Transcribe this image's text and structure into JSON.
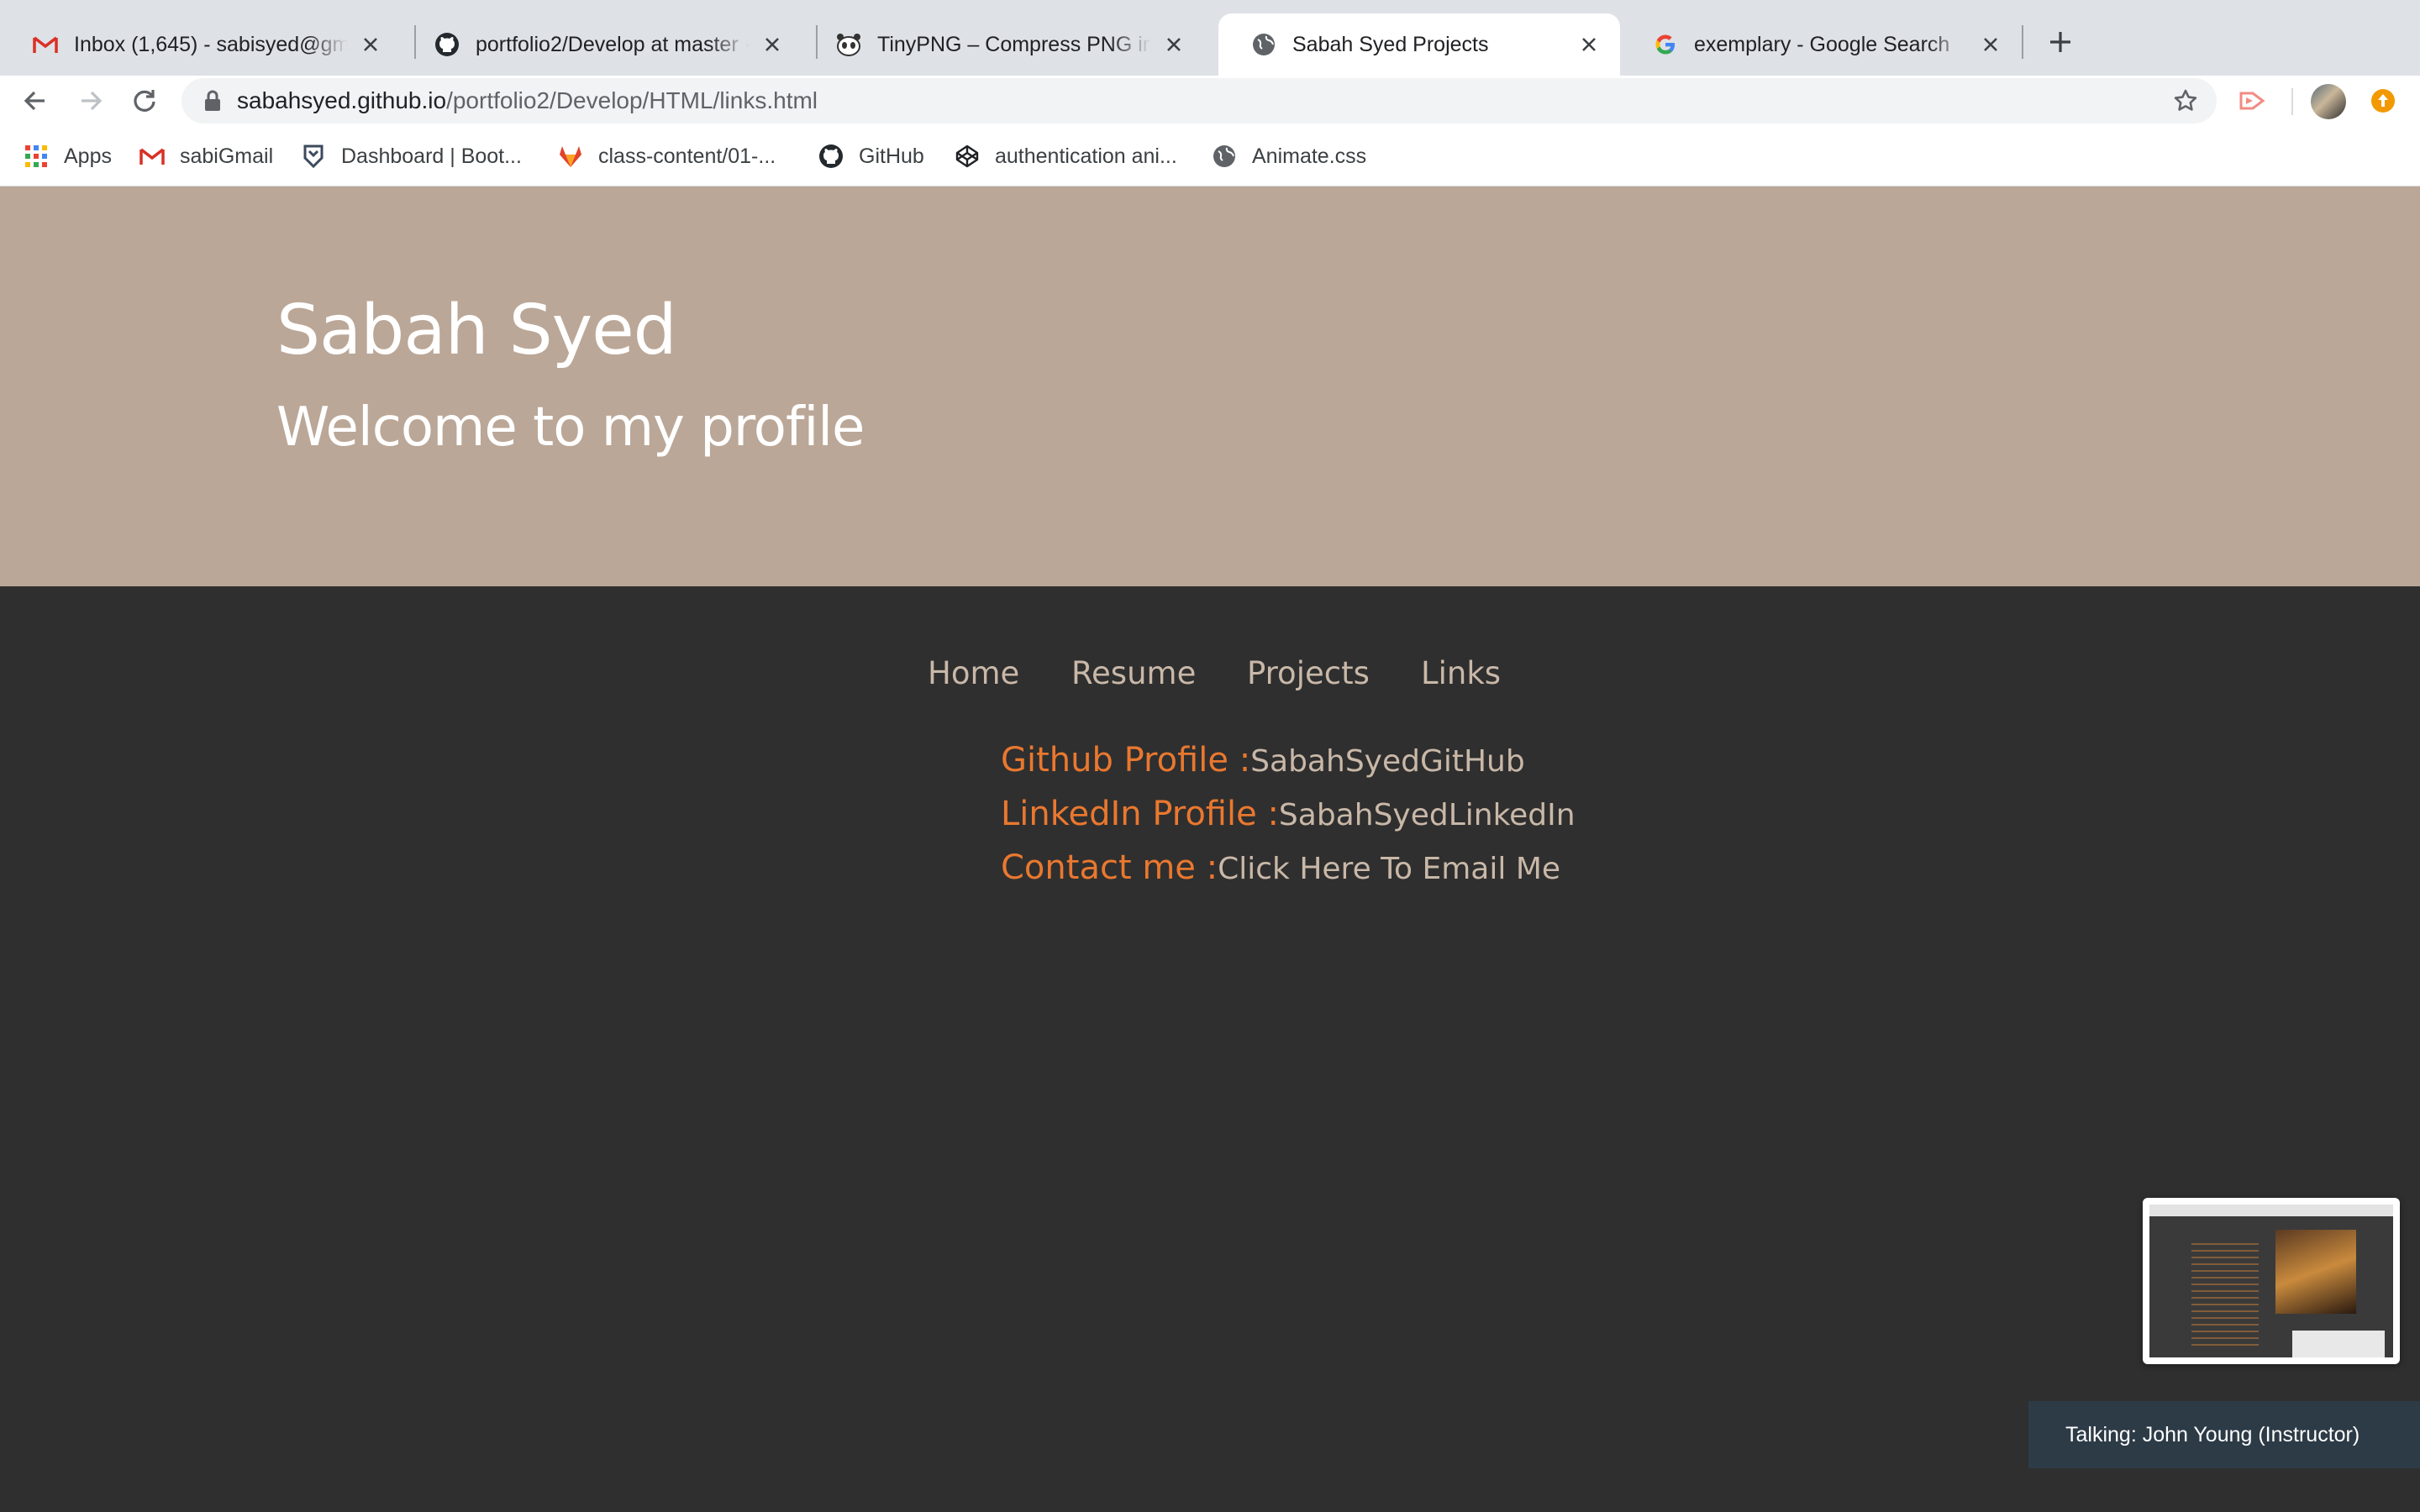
{
  "browser": {
    "tabs": [
      {
        "title": "Inbox (1,645) - sabisyed@gmail.com",
        "icon": "gmail-icon",
        "active": false
      },
      {
        "title": "portfolio2/Develop at master · sabahsyed",
        "icon": "github-icon",
        "active": false
      },
      {
        "title": "TinyPNG – Compress PNG images",
        "icon": "tinypng-panda-icon",
        "active": false
      },
      {
        "title": "Sabah Syed Projects",
        "icon": "globe-icon",
        "active": true
      },
      {
        "title": "exemplary - Google Search",
        "icon": "google-icon",
        "active": false
      }
    ],
    "address": {
      "host": "sabahsyed.github.io",
      "path": "/portfolio2/Develop/HTML/links.html"
    },
    "bookmarks": [
      {
        "label": "Apps",
        "icon": "apps-grid-icon"
      },
      {
        "label": "sabiGmail",
        "icon": "gmail-icon"
      },
      {
        "label": "Dashboard | Boot...",
        "icon": "bootcamp-shield-icon"
      },
      {
        "label": "class-content/01-...",
        "icon": "gitlab-icon"
      },
      {
        "label": "GitHub",
        "icon": "github-icon"
      },
      {
        "label": "authentication ani...",
        "icon": "codepen-icon"
      },
      {
        "label": "Animate.css",
        "icon": "globe-icon"
      }
    ]
  },
  "page": {
    "name": "Sabah Syed",
    "tagline": "Welcome to my profile",
    "nav": [
      "Home",
      "Resume",
      "Projects",
      "Links"
    ],
    "links": [
      {
        "label": "Github Profile :",
        "value": "SabahSyedGitHub"
      },
      {
        "label": "LinkedIn Profile :",
        "value": "SabahSyedLinkedIn"
      },
      {
        "label": "Contact me :",
        "value": "Click Here To Email Me"
      }
    ],
    "colors": {
      "hero_bg": "#bba797",
      "body_bg": "#2f2f2f",
      "accent": "#e9782f",
      "nav_text": "#c9b8a8"
    }
  },
  "overlay": {
    "talking": "Talking: John Young (Instructor)"
  }
}
